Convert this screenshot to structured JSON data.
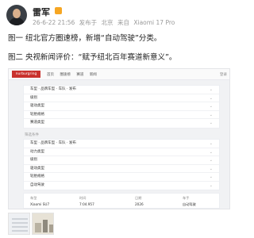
{
  "post": {
    "username": "雷军",
    "date": "26-6-22 21:56",
    "source_prefix": "发布于",
    "location": "北京",
    "device_prefix": "来自",
    "device": "Xiaomi 17 Pro",
    "line1": "图一 纽北官方圈速榜，新增“自动驾驶”分类。",
    "line2": "图二 央视新闻评价：“赋予纽北百年赛道新意义”。"
  },
  "screenshot": {
    "logo": "nurburgring",
    "top_nav": [
      "首页",
      "圈速榜",
      "赛道",
      "新闻"
    ],
    "top_right": "登录",
    "panel1_rows": [
      {
        "label": "车型 · 品牌车型 · 车队 · 发布"
      },
      {
        "label": "级别"
      },
      {
        "label": "驱动类型"
      },
      {
        "label": "轮胎规格"
      },
      {
        "label": "赛道类型"
      }
    ],
    "section_label": "筛选条件",
    "panel2_rows": [
      {
        "label": "车型 · 品牌车型 · 车队 · 发布"
      },
      {
        "label": "动力类型"
      },
      {
        "label": "级别"
      },
      {
        "label": "驱动类型"
      },
      {
        "label": "轮胎规格"
      },
      {
        "label": "自动驾驶"
      }
    ],
    "table_headers": [
      "车型",
      "时间",
      "日期",
      "车手"
    ],
    "table_row": [
      "Xiaomi SU7",
      "7:04.957",
      "2026",
      "自动驾驶"
    ]
  }
}
